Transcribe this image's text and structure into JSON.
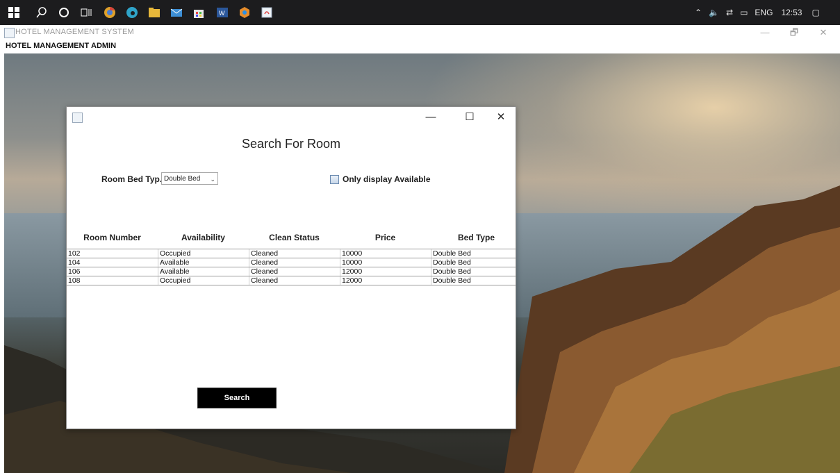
{
  "taskbar": {
    "tray": {
      "lang": "ENG",
      "time": "12:53"
    }
  },
  "app": {
    "title": "HOTEL MANAGEMENT SYSTEM",
    "menu": [
      "HOTEL MANAGEMENT",
      "ADMIN"
    ],
    "controls": {
      "minimize": "—",
      "restore": "🗗",
      "close": "✕"
    }
  },
  "dialog": {
    "controls": {
      "minimize": "—",
      "maximize": "☐",
      "close": "✕"
    },
    "heading": "Search For Room",
    "bed_type_label": "Room Bed Typ...",
    "bed_type_value": "Double Bed",
    "only_available_label": "Only display Available",
    "table": {
      "columns": [
        "Room Number",
        "Availability",
        "Clean Status",
        "Price",
        "Bed Type"
      ],
      "rows": [
        [
          "102",
          "Occupied",
          "Cleaned",
          "10000",
          "Double Bed"
        ],
        [
          "104",
          "Available",
          "Cleaned",
          "10000",
          "Double Bed"
        ],
        [
          "106",
          "Available",
          "Cleaned",
          "12000",
          "Double Bed"
        ],
        [
          "108",
          "Occupied",
          "Cleaned",
          "12000",
          "Double Bed"
        ]
      ]
    },
    "search_button": "Search"
  },
  "colors": {
    "taskbar": "#1c1c1e",
    "button": "#000000"
  }
}
